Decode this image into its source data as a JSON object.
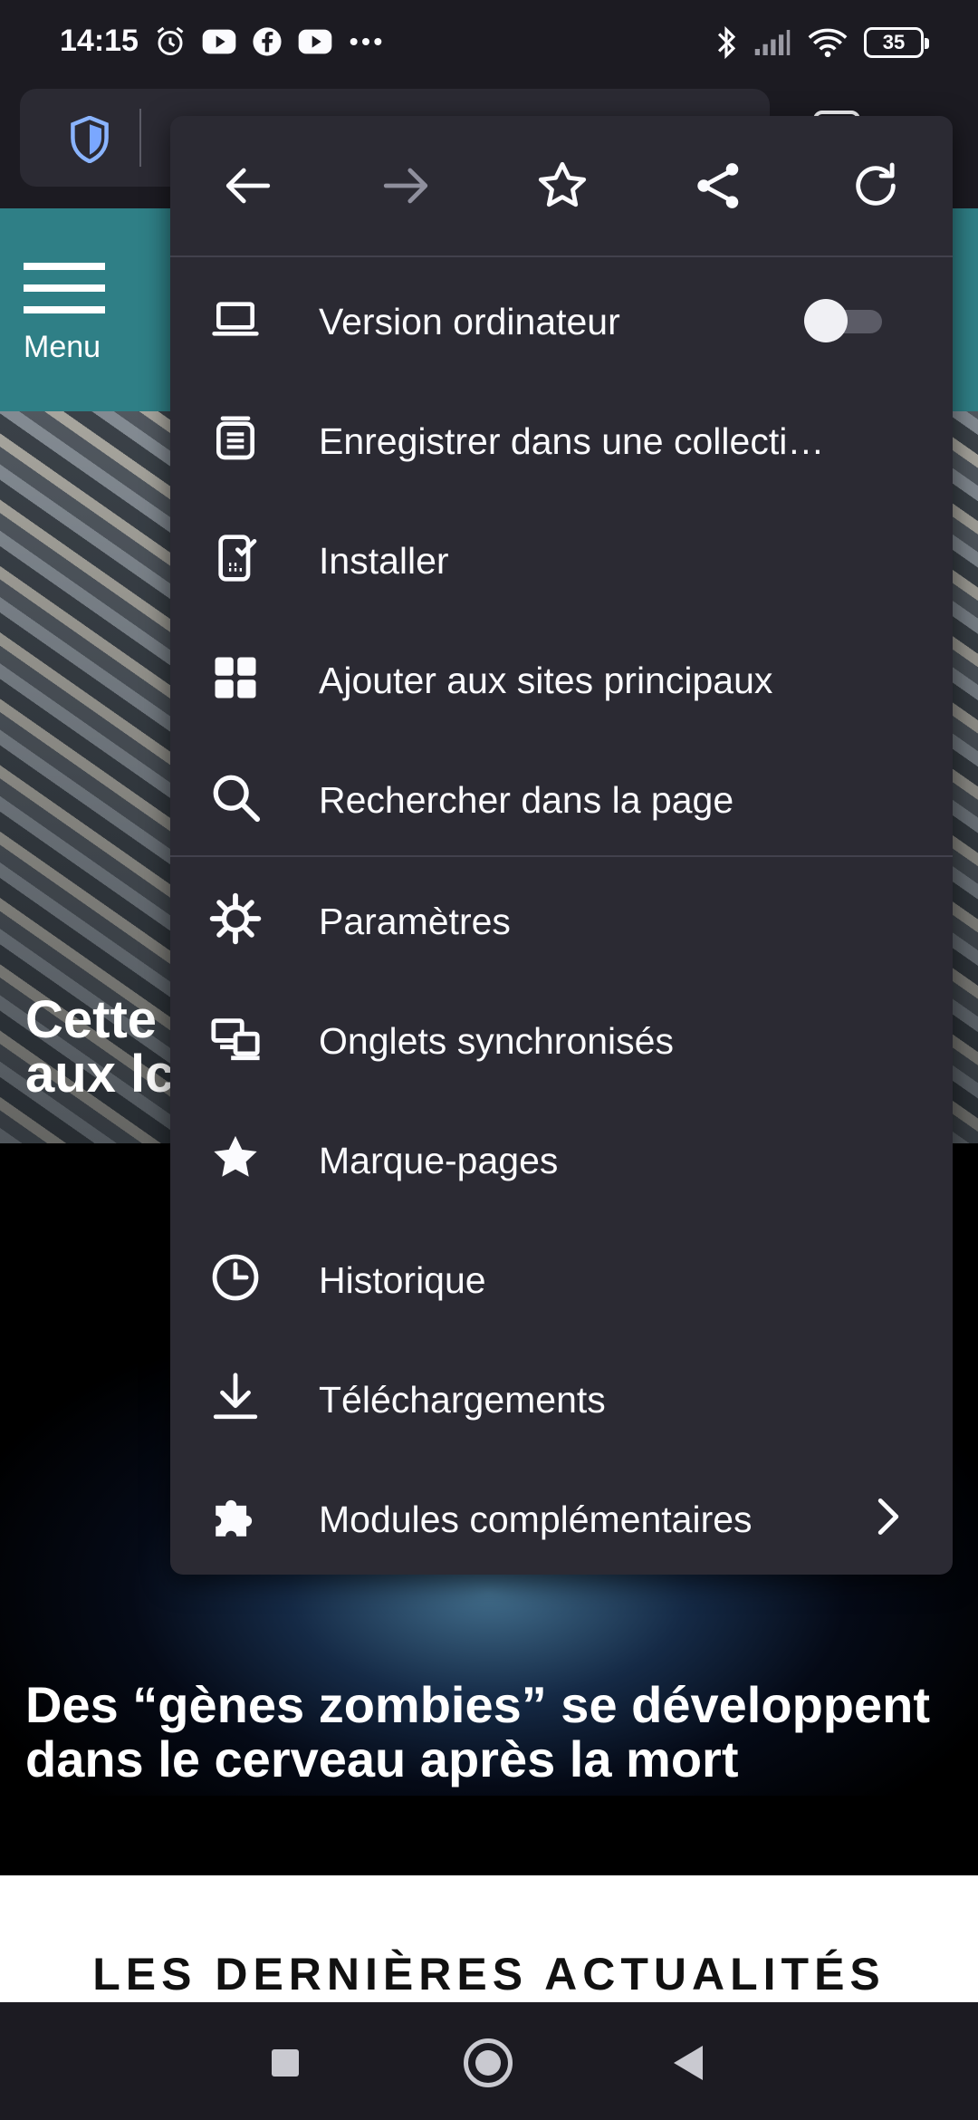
{
  "status_bar": {
    "time": "14:15",
    "battery": "35",
    "left_icons": [
      "alarm-icon",
      "youtube-icon",
      "facebook-icon",
      "youtube-icon",
      "more-dots-icon"
    ],
    "right_icons": [
      "bluetooth-icon",
      "signal-icon",
      "wifi-icon",
      "battery-icon"
    ]
  },
  "web_page": {
    "menu_label": "Menu",
    "hero_title": "Cette\naux lc",
    "neuron_title": "Des “gènes zombies” se développent dans le cerveau après la mort",
    "news_heading": "LES DERNIÈRES ACTUALITÉS"
  },
  "menu": {
    "nav_buttons": [
      {
        "name": "back-icon",
        "enabled": true
      },
      {
        "name": "forward-icon",
        "enabled": false
      },
      {
        "name": "bookmark-star-icon",
        "enabled": true
      },
      {
        "name": "share-icon",
        "enabled": true
      },
      {
        "name": "reload-icon",
        "enabled": true
      }
    ],
    "items": [
      {
        "label": "Version ordinateur",
        "icon": "laptop-icon",
        "toggle": false
      },
      {
        "label": "Enregistrer dans une collecti…",
        "icon": "collection-icon"
      },
      {
        "label": "Installer",
        "icon": "install-phone-icon"
      },
      {
        "label": "Ajouter aux sites principaux",
        "icon": "top-sites-icon"
      },
      {
        "label": "Rechercher dans la page",
        "icon": "search-icon"
      },
      {
        "label": "Paramètres",
        "icon": "settings-gear-icon"
      },
      {
        "label": "Onglets synchronisés",
        "icon": "synced-tabs-icon"
      },
      {
        "label": "Marque-pages",
        "icon": "bookmarks-star-icon"
      },
      {
        "label": "Historique",
        "icon": "history-clock-icon"
      },
      {
        "label": "Téléchargements",
        "icon": "download-icon"
      },
      {
        "label": "Modules complémentaires",
        "icon": "addons-puzzle-icon",
        "has_submenu": true
      }
    ]
  },
  "colors": {
    "menu_bg": "#2b2a33",
    "chrome_bg": "#1c1b22",
    "header_teal": "#2f7f86",
    "text": "#fbfbfe",
    "disabled": "#8f8f9d"
  }
}
